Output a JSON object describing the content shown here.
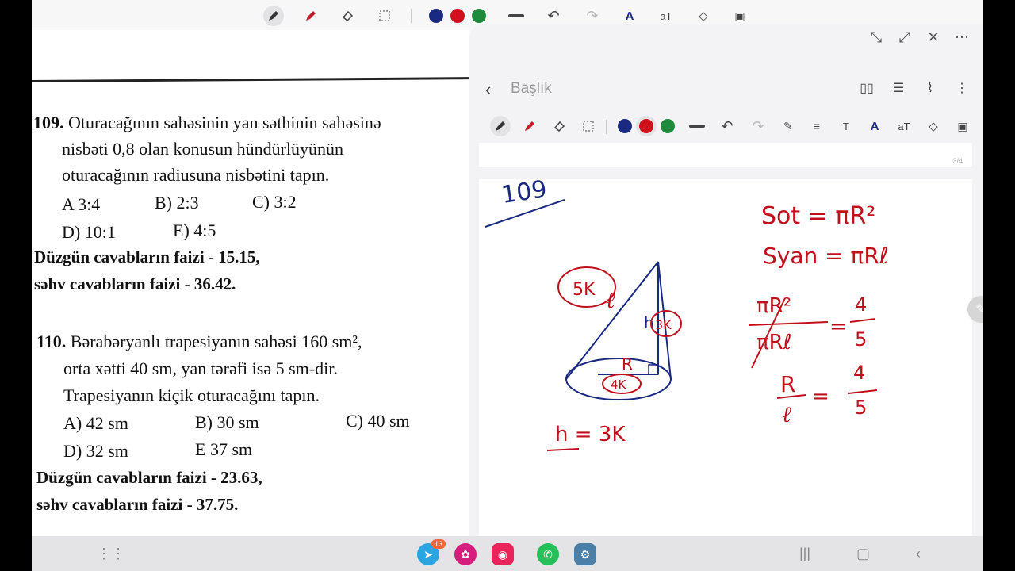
{
  "toolbar": {
    "colors": [
      "#1a2a80",
      "#d0101c",
      "#1e8a3c"
    ]
  },
  "document": {
    "q109": {
      "number": "109.",
      "line1": "Oturacağının sahəsinin yan səthinin sahəsinə",
      "line2": "nisbəti 0,8 olan konusun hündürlüyünün",
      "line3": "oturacağının radiusuna nisbətini tapın.",
      "opt_a": "A 3:4",
      "opt_b": "B) 2:3",
      "opt_c": "C) 3:2",
      "opt_d": "D) 10:1",
      "opt_e": "E) 4:5",
      "correct": "Düzgün cavabların faizi - 15.15,",
      "wrong": "səhv cavabların faizi - 36.42."
    },
    "q110": {
      "number": "110.",
      "line1": "Bərabəryanlı trapesiyanın sahəsi 160 sm²,",
      "line2": "orta xətti 40 sm, yan tərəfi isə 5 sm-dir.",
      "line3": "Trapesiyanın kiçik oturacağını tapın.",
      "opt_a": "A) 42 sm",
      "opt_b": "B) 30 sm",
      "opt_c": "C) 40 sm",
      "opt_d": "D) 32 sm",
      "opt_e": "E 37 sm",
      "correct": "Düzgün cavabların faizi - 23.63,",
      "wrong": "səhv cavabların faizi - 37.75."
    }
  },
  "note": {
    "title": "Başlık",
    "page_number": "3/4",
    "handwriting": {
      "label_109": "109",
      "label_5k": "5K",
      "label_l": "ℓ",
      "label_h": "h",
      "label_3k": "3K",
      "label_r": "R",
      "label_4k": "4K",
      "eq_h": "h = 3K",
      "eq_sot": "Sot = πR²",
      "eq_syan": "Syan = πRℓ",
      "frac1_num": "πR²",
      "frac1_den": "πRℓ",
      "frac_val_num": "4",
      "frac_val_den": "5",
      "frac2_num": "R",
      "frac2_den": "ℓ"
    }
  },
  "navbar": {
    "telegram_badge": "13"
  }
}
